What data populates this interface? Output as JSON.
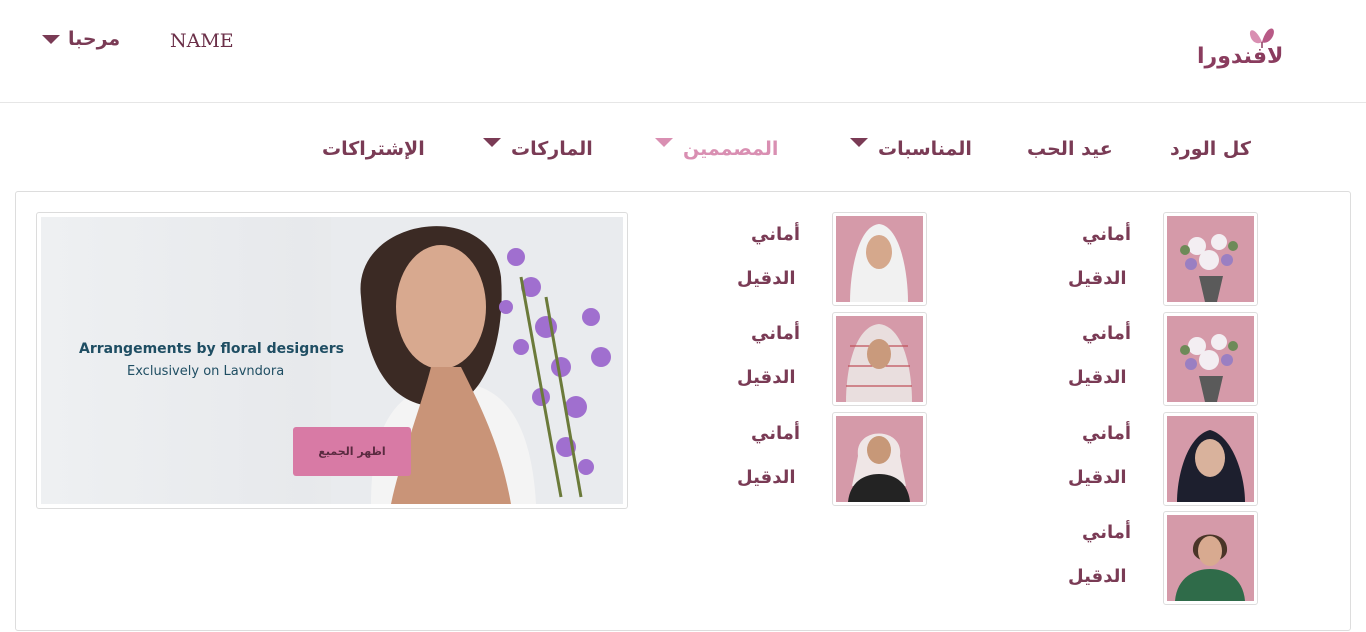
{
  "header": {
    "greeting": "مرحبا",
    "username": "NAME",
    "logo_text": "لافندورا"
  },
  "nav": {
    "items": [
      {
        "label": "كل الورد",
        "has_dropdown": false,
        "active": false
      },
      {
        "label": "عيد الحب",
        "has_dropdown": false,
        "active": false
      },
      {
        "label": "المناسبات",
        "has_dropdown": true,
        "active": false
      },
      {
        "label": "المصممين",
        "has_dropdown": true,
        "active": true
      },
      {
        "label": "الماركات",
        "has_dropdown": true,
        "active": false
      },
      {
        "label": "الإشتراكات",
        "has_dropdown": false,
        "active": false
      }
    ]
  },
  "designers": {
    "col1": [
      {
        "first": "أماني",
        "last": "الدقيل",
        "photo": "flowers-bouquet"
      },
      {
        "first": "أماني",
        "last": "الدقيل",
        "photo": "flowers-bouquet"
      },
      {
        "first": "أماني",
        "last": "الدقيل",
        "photo": "woman-black-hijab"
      },
      {
        "first": "أماني",
        "last": "الدقيل",
        "photo": "woman-green-jacket"
      }
    ],
    "col2": [
      {
        "first": "أماني",
        "last": "الدقيل",
        "photo": "woman-white-scarf"
      },
      {
        "first": "أماني",
        "last": "الدقيل",
        "photo": "man-red-shemagh"
      },
      {
        "first": "أماني",
        "last": "الدقيل",
        "photo": "man-black-thobe"
      }
    ]
  },
  "banner": {
    "title": "Arrangements by floral designers",
    "subtitle": "Exclusively on Lavndora",
    "button_label": "اظهر الجميع"
  },
  "colors": {
    "brand": "#7a3b55",
    "active": "#d98fb2",
    "button": "#d87aa5",
    "thumb_bg": "#d59aa9"
  }
}
